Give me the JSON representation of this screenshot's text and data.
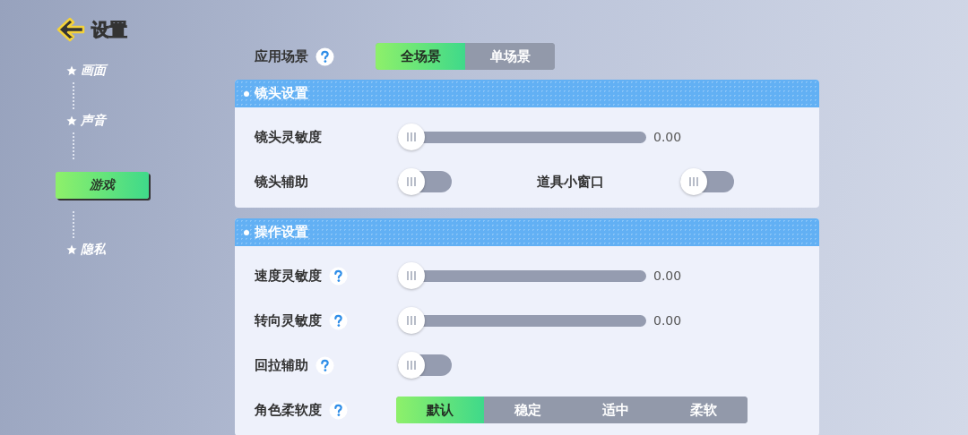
{
  "title": "设置",
  "nav": [
    {
      "label": "画面",
      "selected": false
    },
    {
      "label": "声音",
      "selected": false
    },
    {
      "label": "游戏",
      "selected": true
    },
    {
      "label": "隐私",
      "selected": false
    }
  ],
  "scene": {
    "label": "应用场景",
    "help": true,
    "options": [
      {
        "label": "全场景",
        "selected": true
      },
      {
        "label": "单场景",
        "selected": false
      }
    ]
  },
  "sections": [
    {
      "title": "镜头设置",
      "rows": [
        {
          "kind": "slider",
          "label": "镜头灵敏度",
          "level": 0,
          "reading": "0.00"
        },
        {
          "kind": "toggles",
          "items": [
            {
              "label": "镜头辅助",
              "on": false
            },
            {
              "label": "道具小窗口",
              "on": false
            }
          ]
        }
      ]
    },
    {
      "title": "操作设置",
      "rows": [
        {
          "kind": "slider",
          "label": "速度灵敏度",
          "help": true,
          "level": 0,
          "reading": "0.00"
        },
        {
          "kind": "slider",
          "label": "转向灵敏度",
          "help": true,
          "level": 0,
          "reading": "0.00"
        },
        {
          "kind": "toggles",
          "items": [
            {
              "label": "回拉辅助",
              "help": true,
              "on": false
            }
          ]
        },
        {
          "kind": "segmented",
          "label": "角色柔软度",
          "help": true,
          "options": [
            {
              "label": "默认",
              "selected": true
            },
            {
              "label": "稳定",
              "selected": false
            },
            {
              "label": "适中",
              "selected": false
            },
            {
              "label": "柔软",
              "selected": false
            }
          ]
        }
      ]
    }
  ]
}
